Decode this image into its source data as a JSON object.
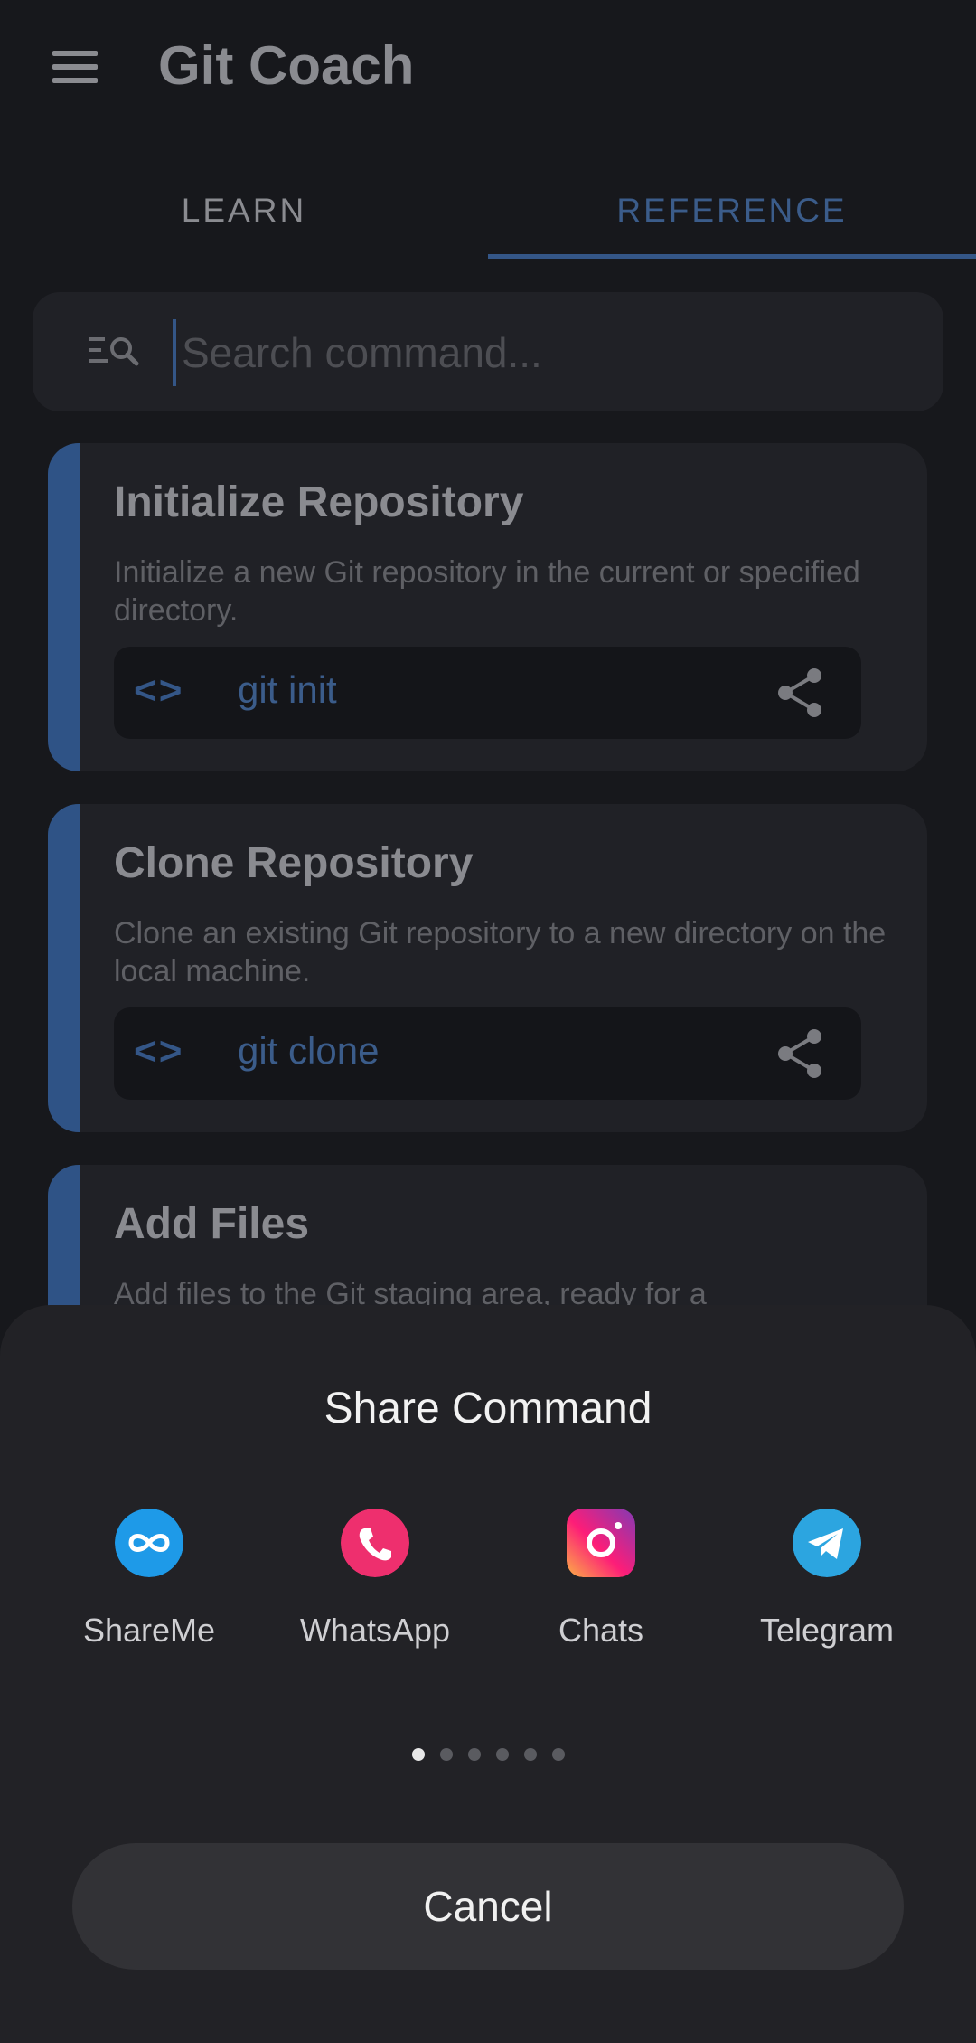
{
  "app": {
    "title": "Git Coach"
  },
  "tabs": [
    {
      "label": "LEARN",
      "active": false
    },
    {
      "label": "REFERENCE",
      "active": true
    }
  ],
  "search": {
    "placeholder": "Search command...",
    "value": ""
  },
  "cards": [
    {
      "title": "Initialize Repository",
      "description": "Initialize a new Git repository in the current or specified directory.",
      "command": "git init"
    },
    {
      "title": "Clone Repository",
      "description": "Clone an existing Git repository to a new directory on the local machine.",
      "command": "git clone"
    },
    {
      "title": "Add Files",
      "description": "Add files to the Git staging area, ready for a",
      "command": ""
    }
  ],
  "share_sheet": {
    "title": "Share Command",
    "targets": [
      {
        "label": "ShareMe",
        "icon": "shareme-icon"
      },
      {
        "label": "WhatsApp",
        "icon": "whatsapp-icon"
      },
      {
        "label": "Chats",
        "icon": "instagram-icon"
      },
      {
        "label": "Telegram",
        "icon": "telegram-icon"
      }
    ],
    "page_count": 6,
    "active_page": 1,
    "cancel_label": "Cancel"
  },
  "colors": {
    "accent": "#345687",
    "background": "#17181c",
    "sheet": "#222226"
  }
}
